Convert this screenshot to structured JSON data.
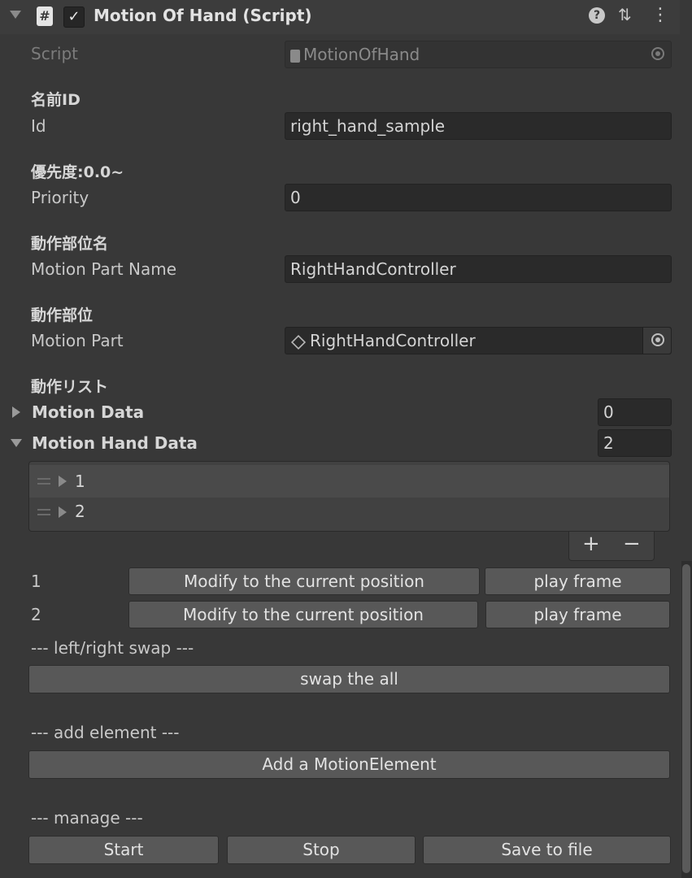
{
  "header": {
    "title": "Motion Of Hand (Script)",
    "script_icon": "#",
    "enabled_checkbox": "✓",
    "help_icon": "?",
    "preset_icon": "⇅",
    "more_icon": "⋮"
  },
  "script_field": {
    "label": "Script",
    "value": "MotionOfHand"
  },
  "fields": {
    "id": {
      "tooltip": "名前ID",
      "label": "Id",
      "value": "right_hand_sample"
    },
    "priority": {
      "tooltip": "優先度:0.0~",
      "label": "Priority",
      "value": "0"
    },
    "motion_part_name": {
      "tooltip": "動作部位名",
      "label": "Motion Part Name",
      "value": "RightHandController"
    },
    "motion_part": {
      "tooltip": "動作部位",
      "label": "Motion Part",
      "value": "RightHandController",
      "icon": "cube-icon"
    }
  },
  "motion_list": {
    "tooltip": "動作リスト",
    "motion_data": {
      "label": "Motion Data",
      "count": "0"
    },
    "motion_hand_data": {
      "label": "Motion Hand Data",
      "count": "2",
      "items": [
        "1",
        "2"
      ]
    },
    "add_button": "+",
    "remove_button": "−"
  },
  "frames": [
    {
      "index": "1",
      "modify_label": "Modify to the current position",
      "play_label": "play frame"
    },
    {
      "index": "2",
      "modify_label": "Modify to the current position",
      "play_label": "play frame"
    }
  ],
  "swap_section": {
    "label": "--- left/right swap ---",
    "button": "swap the all"
  },
  "add_section": {
    "label": "--- add element ---",
    "button": "Add a MotionElement"
  },
  "manage_section": {
    "label": "--- manage ---",
    "start": "Start",
    "stop": "Stop",
    "save": "Save to file"
  },
  "colors": {
    "background": "#383838",
    "field": "#2a2a2a",
    "button": "#585858",
    "text": "#d2d2d2"
  }
}
